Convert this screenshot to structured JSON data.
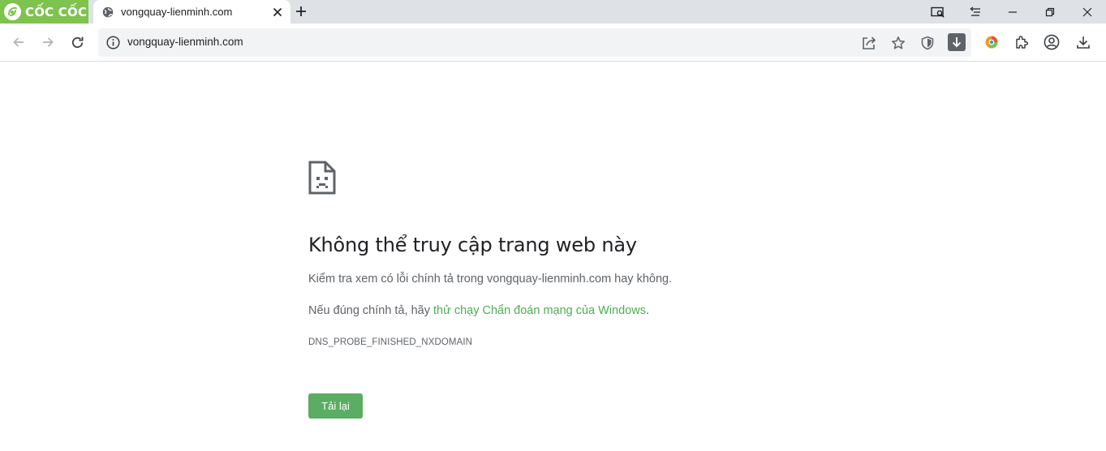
{
  "browser": {
    "brand_name": "CỐC CỐC",
    "brand_color": "#7ec34d",
    "tab": {
      "title": "vongquay-lienminh.com",
      "favicon": "globe-icon"
    },
    "address_bar": {
      "url": "vongquay-lienminh.com",
      "info_icon": "info-icon"
    }
  },
  "error_page": {
    "title": "Không thể truy cập trang web này",
    "check_text": "Kiểm tra xem có lỗi chính tả trong vongquay-lienminh.com hay không.",
    "spelling_prefix": "Nếu đúng chính tả, hãy ",
    "diagnostics_link": "thử chạy Chẩn đoán mạng của Windows",
    "spelling_suffix": ".",
    "error_code": "DNS_PROBE_FINISHED_NXDOMAIN",
    "reload_button": "Tải lại",
    "accent_color": "#5aad62"
  }
}
